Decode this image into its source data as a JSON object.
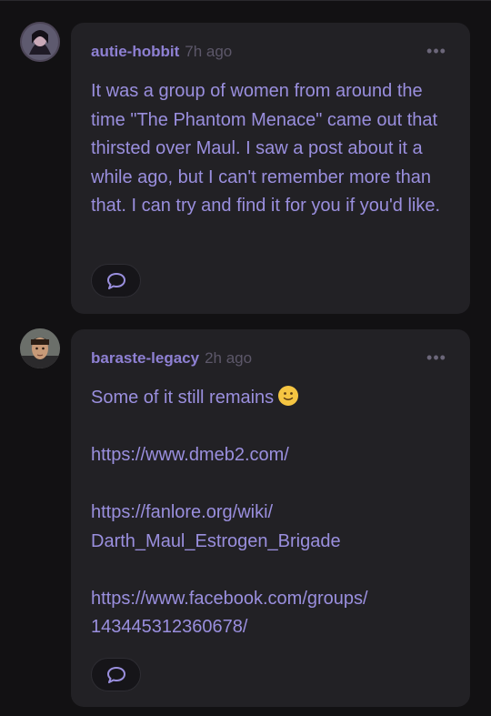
{
  "comments": [
    {
      "username": "autie-hobbit",
      "time": "7h ago",
      "more_icon": "•••",
      "paragraphs": [
        "It was a group of women from around the time \"The Phantom Menace\" came out that thirsted over Maul. I saw a post about it a while ago, but I can't remember more than that. I can try and find it for you if you'd like."
      ],
      "reply_icon": "speech-bubble-icon"
    },
    {
      "username": "baraste-legacy",
      "time": "2h ago",
      "more_icon": "•••",
      "text_line": "Some of it still remains",
      "emoji": "slightly-smiling-face",
      "links": [
        "https://www.dmeb2.com/",
        "https://fanlore.org/wiki/ Darth_Maul_Estrogen_Brigade",
        "https://www.facebook.com/groups/ 143445312360678/"
      ],
      "reply_icon": "speech-bubble-icon"
    }
  ],
  "colors": {
    "background": "#121113",
    "bubble": "#222125",
    "username": "#8e80d3",
    "body_text": "#9a8fde",
    "timestamp": "#5c5769"
  }
}
